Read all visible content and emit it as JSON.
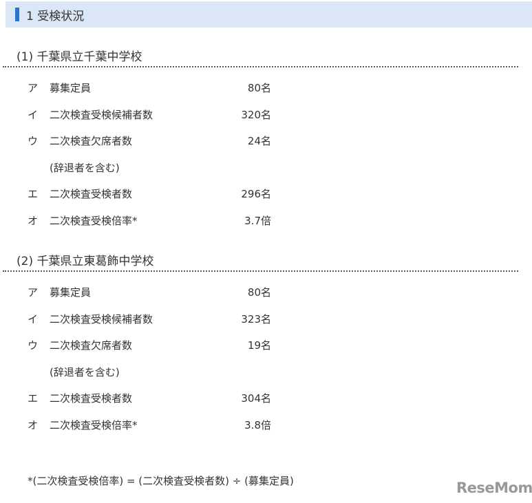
{
  "header": {
    "title": "1 受検状況"
  },
  "sections": [
    {
      "title": "(1)  千葉県立千葉中学校",
      "rows": [
        {
          "k": "ア",
          "l": "募集定員",
          "v": "80名"
        },
        {
          "k": "イ",
          "l": "二次検査受検候補者数",
          "v": "320名"
        },
        {
          "k": "ウ",
          "l": "二次検査欠席者数",
          "v": "24名"
        },
        {
          "k": "",
          "l": "(辞退者を含む)",
          "v": ""
        },
        {
          "k": "エ",
          "l": "二次検査受検者数",
          "v": "296名"
        },
        {
          "k": "オ",
          "l": "二次検査受検倍率*",
          "v": "3.7倍"
        }
      ]
    },
    {
      "title": "(2)  千葉県立東葛飾中学校",
      "rows": [
        {
          "k": "ア",
          "l": "募集定員",
          "v": "80名"
        },
        {
          "k": "イ",
          "l": "二次検査受検候補者数",
          "v": "323名"
        },
        {
          "k": "ウ",
          "l": "二次検査欠席者数",
          "v": "19名"
        },
        {
          "k": "",
          "l": "(辞退者を含む)",
          "v": ""
        },
        {
          "k": "エ",
          "l": "二次検査受検者数",
          "v": "304名"
        },
        {
          "k": "オ",
          "l": "二次検査受検倍率*",
          "v": "3.8倍"
        }
      ]
    }
  ],
  "note": "*(二次検査受検倍率) = (二次検査受検者数) ÷ (募集定員)",
  "logo": "ReseMom"
}
